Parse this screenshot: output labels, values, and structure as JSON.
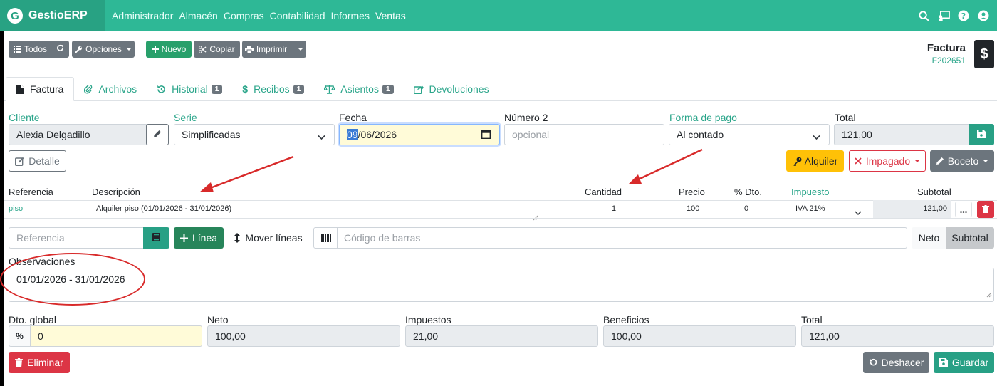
{
  "navbar": {
    "brand_letter": "G",
    "brand_name": "GestioERP",
    "menu": [
      "Administrador",
      "Almacén",
      "Compras",
      "Contabilidad",
      "Informes",
      "Ventas"
    ]
  },
  "toolbar": {
    "all_label": "Todos",
    "options_label": "Opciones",
    "new_label": "Nuevo",
    "copy_label": "Copiar",
    "print_label": "Imprimir"
  },
  "document": {
    "type": "Factura",
    "code": "F202651"
  },
  "tabs": [
    {
      "label": "Factura",
      "badge": ""
    },
    {
      "label": "Archivos",
      "badge": ""
    },
    {
      "label": "Historial",
      "badge": "1"
    },
    {
      "label": "Recibos",
      "badge": "1"
    },
    {
      "label": "Asientos",
      "badge": "1"
    },
    {
      "label": "Devoluciones",
      "badge": ""
    }
  ],
  "header": {
    "client_label": "Cliente",
    "client_value": "Alexia Delgadillo",
    "series_label": "Serie",
    "series_value": "Simplificadas",
    "date_label": "Fecha",
    "date_day": "09",
    "date_rest": "/06/2026",
    "number2_label": "Número 2",
    "number2_placeholder": "opcional",
    "payment_label": "Forma de pago",
    "payment_value": "Al contado",
    "total_label": "Total",
    "total_value": "121,00"
  },
  "actions": {
    "detail_label": "Detalle",
    "rent_label": "Alquiler",
    "unpaid_label": "Impagado",
    "draft_label": "Boceto"
  },
  "lines": {
    "columns": {
      "reference": "Referencia",
      "description": "Descripción",
      "quantity": "Cantidad",
      "price": "Precio",
      "discount": "% Dto.",
      "tax": "Impuesto",
      "subtotal": "Subtotal"
    },
    "rows": [
      {
        "reference": "piso",
        "description": "Alquiler piso (01/01/2026 - 31/01/2026)",
        "quantity": "1",
        "price": "100",
        "discount": "0",
        "tax": "IVA 21%",
        "subtotal": "121,00"
      }
    ]
  },
  "add_line": {
    "reference_placeholder": "Referencia",
    "line_label": "Línea",
    "move_label": "Mover líneas",
    "barcode_placeholder": "Código de barras",
    "net_label": "Neto",
    "subtotal_label": "Subtotal"
  },
  "notes": {
    "label": "Observaciones",
    "value": "01/01/2026 - 31/01/2026"
  },
  "totals": {
    "discount_label": "Dto. global",
    "discount_symbol": "%",
    "discount_value": "0",
    "net_label": "Neto",
    "net_value": "100,00",
    "taxes_label": "Impuestos",
    "taxes_value": "21,00",
    "profit_label": "Beneficios",
    "profit_value": "100,00",
    "total_label": "Total",
    "total_value": "121,00"
  },
  "footer": {
    "delete_label": "Eliminar",
    "undo_label": "Deshacer",
    "save_label": "Guardar"
  },
  "colors": {
    "brand": "#2eb896",
    "accent_link": "#2aa58a",
    "danger": "#dc3545",
    "warning": "#ffc107",
    "success": "#28a06b",
    "annotation": "#d82a2a"
  }
}
